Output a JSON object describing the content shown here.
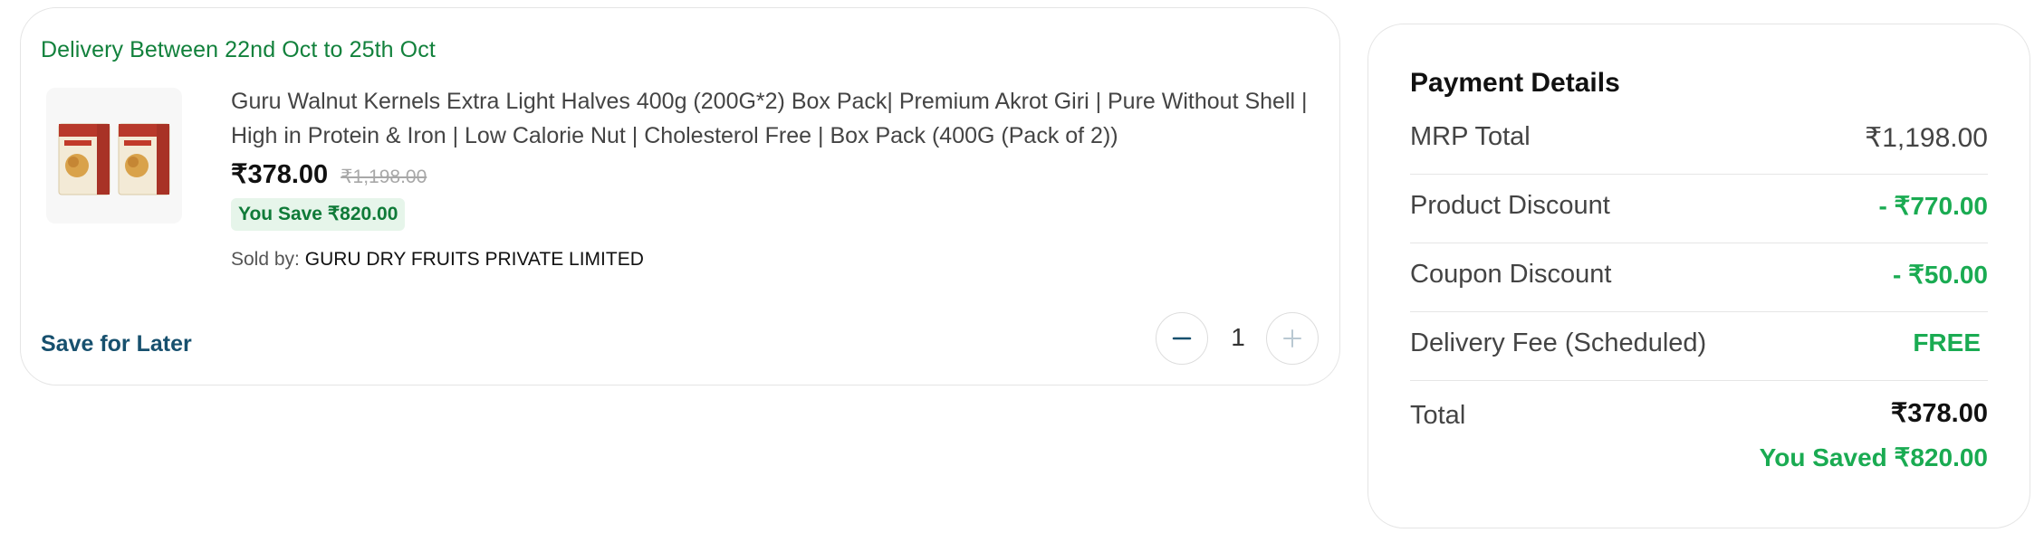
{
  "cart_item": {
    "delivery_text": "Delivery Between 22nd Oct to 25th Oct",
    "product": {
      "image_icon": "product-box-image",
      "title": "Guru Walnut Kernels Extra Light Halves 400g (200G*2) Box Pack| Premium Akrot Giri | Pure Without Shell | High in Protein & Iron | Low Calorie Nut | Cholesterol Free | Box Pack (400G (Pack of 2))",
      "price": "₹378.00",
      "mrp": "₹1,198.00",
      "save_text": "You Save ₹820.00",
      "sold_by_label": "Sold by:",
      "seller": "GURU DRY FRUITS PRIVATE LIMITED"
    },
    "save_for_later_label": "Save for Later",
    "quantity": {
      "value": "1",
      "minus_icon": "minus-icon",
      "plus_icon": "plus-icon"
    }
  },
  "payment_details": {
    "title": "Payment Details",
    "rows": [
      {
        "label": "MRP Total",
        "value": "₹1,198.00"
      },
      {
        "label": "Product Discount",
        "value": "- ₹770.00"
      },
      {
        "label": "Coupon Discount",
        "value": "- ₹50.00"
      },
      {
        "label": "Delivery Fee (Scheduled)",
        "value": "FREE"
      }
    ],
    "total_label": "Total",
    "total_value": "₹378.00",
    "saved_text": "You Saved ₹820.00"
  },
  "colors": {
    "delivery_green": "#12813c",
    "discount_green": "#1aab52",
    "save_badge_bg": "#e6f5ea",
    "link_blue": "#17506e",
    "border": "#e5e5e5"
  }
}
